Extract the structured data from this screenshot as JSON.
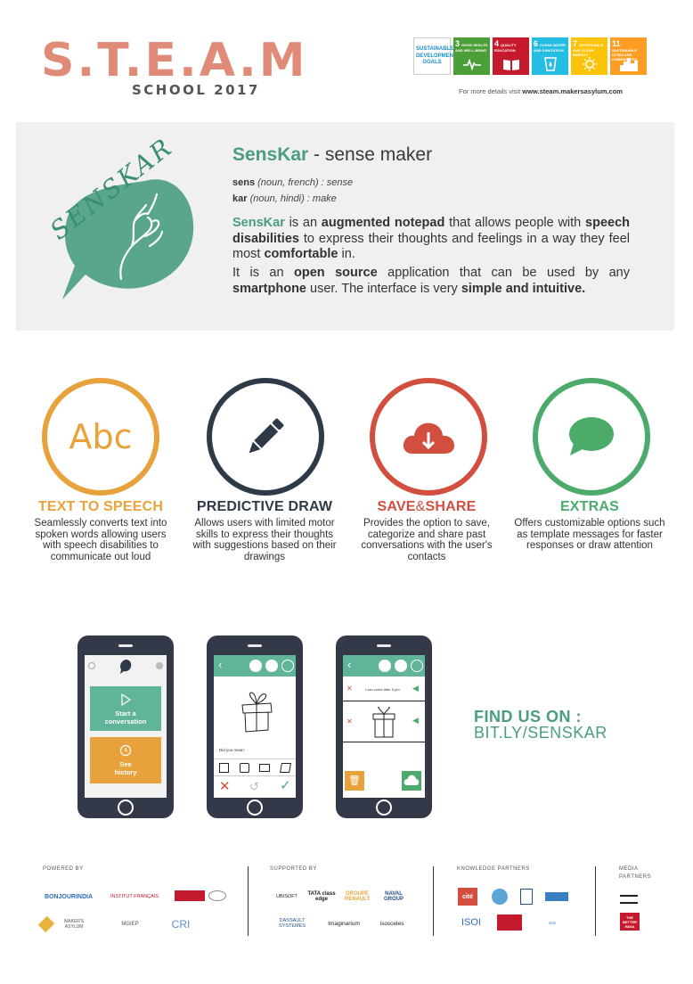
{
  "header": {
    "title": "S.T.E.A.M",
    "subtitle": "SCHOOL 2017",
    "details_prefix": "For more details visit",
    "details_url": "www.steam.makersasylum.com",
    "sdg_intro": "SUSTAINABLE DEVELOPMENT GOALS",
    "sdgs": [
      {
        "num": "3",
        "label": "GOOD HEALTH AND WELL-BEING",
        "color": "#4c9f38",
        "icon": "heartbeat-icon"
      },
      {
        "num": "4",
        "label": "QUALITY EDUCATION",
        "color": "#c5192d",
        "icon": "book-icon"
      },
      {
        "num": "6",
        "label": "CLEAN WATER AND SANITATION",
        "color": "#26bde2",
        "icon": "water-icon"
      },
      {
        "num": "7",
        "label": "AFFORDABLE AND CLEAN ENERGY",
        "color": "#fcc30b",
        "icon": "sun-icon"
      },
      {
        "num": "11",
        "label": "SUSTAINABLE CITIES AND COMMUNITIES",
        "color": "#fd9d24",
        "icon": "city-icon"
      }
    ]
  },
  "intro": {
    "bubble_text": "SENSKAR",
    "brand": "SensKar",
    "tagline": " - sense maker",
    "def1_word": "sens",
    "def1_rest": " (noun, french) : sense",
    "def2_word": "kar",
    "def2_rest": " (noun, hindi) : make",
    "para1": [
      {
        "t": "SensKar",
        "s": "brand"
      },
      {
        "t": " is an ",
        "s": ""
      },
      {
        "t": "augmented notepad",
        "s": "b"
      },
      {
        "t": " that allows people with ",
        "s": ""
      },
      {
        "t": "speech disabilities",
        "s": "b"
      },
      {
        "t": " to express their thoughts and feelings in a way they feel most ",
        "s": ""
      },
      {
        "t": "comfortable",
        "s": "b"
      },
      {
        "t": " in.",
        "s": ""
      }
    ],
    "para2": [
      {
        "t": "It is an ",
        "s": ""
      },
      {
        "t": "open source",
        "s": "b"
      },
      {
        "t": " application that can be used by any ",
        "s": ""
      },
      {
        "t": "smartphone",
        "s": "b"
      },
      {
        "t": " user. The interface is very ",
        "s": ""
      },
      {
        "t": "simple and intuitive.",
        "s": "b"
      }
    ]
  },
  "features": [
    {
      "title": "TEXT TO SPEECH",
      "desc": "Seamlessly converts text into spoken words allowing users with speech disabilities to communicate out loud",
      "color": "#e8a23c",
      "icon_text": "Abc"
    },
    {
      "title": "PREDICTIVE DRAW",
      "desc": "Allows users with limited motor skills to express their thoughts with suggestions based on their drawings",
      "color": "#2e3a48"
    },
    {
      "title_a": "SAVE",
      "title_amp": "&",
      "title_b": "SHARE",
      "desc": "Provides the option to save, categorize and share past conversations with the user's contacts",
      "color": "#d24f3f"
    },
    {
      "title": "EXTRAS",
      "desc": "Offers customizable options such as template messages for faster responses or draw attention",
      "color": "#4caa6a"
    }
  ],
  "phones": {
    "p1": {
      "start_label": "Start a conversation",
      "history_label": "See history"
    },
    "p2": {
      "did_you_mean": "Did you mean:"
    },
    "p3": {
      "message": "I can come after 5 pm."
    }
  },
  "find": {
    "label": "FIND US ON :",
    "url": "BIT.LY/SENSKAR"
  },
  "footer": {
    "powered_by": "POWERED BY",
    "supported_by": "SUPPORTED BY",
    "knowledge_partners": "KNOWLEDGE PARTNERS",
    "media_partners_1": "MEDIA",
    "media_partners_2": "PARTNERS",
    "powered_logos": [
      "BONJOURINDIA",
      "INSTITUT FRANÇAIS",
      "MAKER'S ASYLUM",
      "MGIEP",
      "CRI"
    ],
    "supported_logos": [
      "UBISOFT",
      "TATA class edge",
      "GROUPE RENAULT",
      "NAVAL GROUP",
      "DASSAULT SYSTEMES",
      "Imaginarium",
      "isosceles"
    ],
    "knowledge_logos": [
      "cité",
      "ISOI",
      "ICS"
    ],
    "media_logos": [
      "THE BETTER INDIA"
    ]
  }
}
